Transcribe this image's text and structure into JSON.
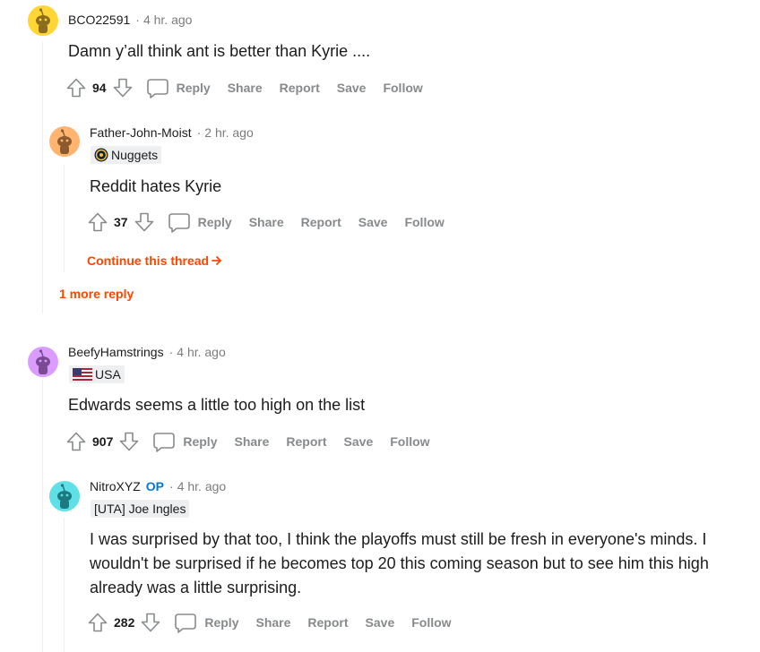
{
  "comments": [
    {
      "author": "BCO22591",
      "time": "4 hr. ago",
      "body": "Damn y’all think ant is better than Kyrie ....",
      "votes": "94",
      "avatar_color": "#ffd635"
    },
    {
      "author": "Father-John-Moist",
      "time": "2 hr. ago",
      "flair": "Nuggets",
      "flair_icon": "nuggets-logo-icon",
      "body": "Reddit hates Kyrie",
      "votes": "37",
      "avatar_color": "#ffb470"
    },
    {
      "author": "BeefyHamstrings",
      "time": "4 hr. ago",
      "flair": "USA",
      "flair_icon": "us-flag-icon",
      "body": "Edwards seems a little too high on the list",
      "votes": "907",
      "avatar_color": "#db9cff"
    },
    {
      "author": "NitroXYZ",
      "op_badge": "OP",
      "time": "4 hr. ago",
      "flair": "[UTA] Joe Ingles",
      "body_lines": [
        "I was surprised by that too, I think the playoffs must still be fresh in everyone's minds. I",
        "wouldn't be surprised if he becomes top 20 this coming season but to see him this high",
        "already was a little surprising."
      ],
      "votes": "282",
      "avatar_color": "#46d160"
    }
  ],
  "actions": {
    "reply": "Reply",
    "share": "Share",
    "report": "Report",
    "save": "Save",
    "follow": "Follow"
  },
  "continue_thread": "Continue this thread",
  "more_replies": "1 more reply",
  "colors": {
    "accent_orange": "#ff4500",
    "op_blue": "#0079d3",
    "muted": "#878a8c"
  }
}
